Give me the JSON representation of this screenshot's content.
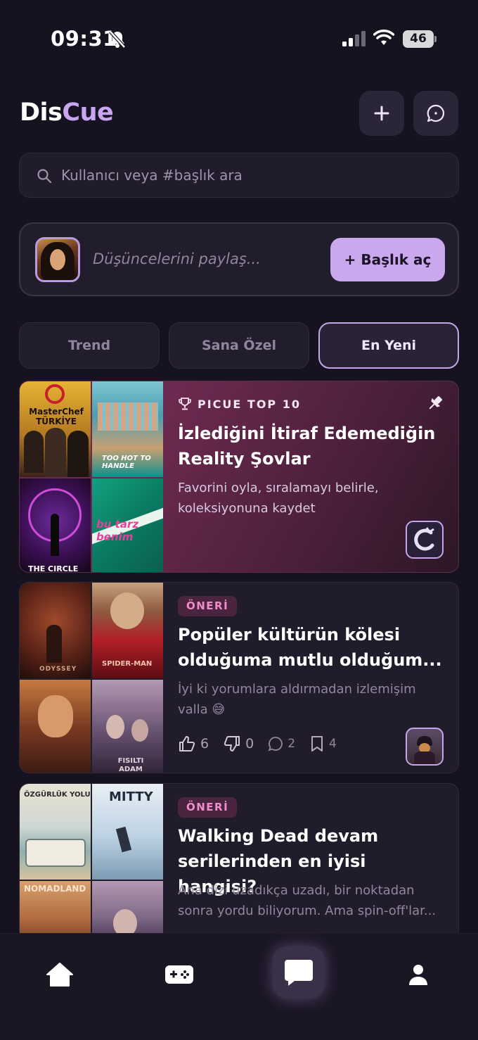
{
  "status_bar": {
    "time": "09:31",
    "battery": "46"
  },
  "header": {
    "logo_part1": "Dis",
    "logo_part2": "Cue"
  },
  "search": {
    "placeholder": "Kullanıcı veya #başlık ara"
  },
  "composer": {
    "placeholder": "Düşüncelerini paylaş...",
    "button_label": "+ Başlık aç"
  },
  "tabs": [
    {
      "label": "Trend",
      "active": false
    },
    {
      "label": "Sana Özel",
      "active": false
    },
    {
      "label": "En Yeni",
      "active": true
    }
  ],
  "cards": [
    {
      "kicker": "PICUE TOP 10",
      "title": "İzlediğini İtiraf Edemediğin Reality Şovlar",
      "desc_line1": "Favorini oyla, sıralamayı belirle,",
      "desc_line2": "koleksiyonuna kaydet",
      "pinned": true,
      "thumbs": [
        "MasterChef TÜRKİYE",
        "TOO HOT TO HANDLE",
        "THE CIRCLE",
        "bu tarz benim"
      ]
    },
    {
      "tag": "ÖNERİ",
      "title": "Popüler kültürün kölesi olduğuma mutlu olduğum...",
      "desc_line1": "İyi ki yorumlara aldırmadan izlemişim",
      "desc_line2": "valla 😅",
      "likes": "6",
      "dislikes": "0",
      "comments": "2",
      "saves": "4",
      "thumbs": [
        "ODYSSEY",
        "SPIDER-MAN",
        "",
        "FISILTI ADAM"
      ]
    },
    {
      "tag": "ÖNERİ",
      "title": "Walking Dead devam serilerinden en iyisi hangisi?",
      "desc_line1": "Ana dizi uzadıkça uzadı, bir noktadan",
      "desc_line2": "sonra yordu biliyorum. Ama spin-off'lar...",
      "thumbs": [
        "ÖZGÜRLÜK YOLU",
        "MITTY",
        "NOMADLAND",
        ""
      ]
    }
  ],
  "colors": {
    "accent": "#c9a8ee",
    "background": "#16121f",
    "tag": "#f08ec9"
  },
  "nav": {
    "items": [
      "home-icon",
      "gamepad-icon",
      "chat-icon",
      "profile-icon"
    ]
  }
}
